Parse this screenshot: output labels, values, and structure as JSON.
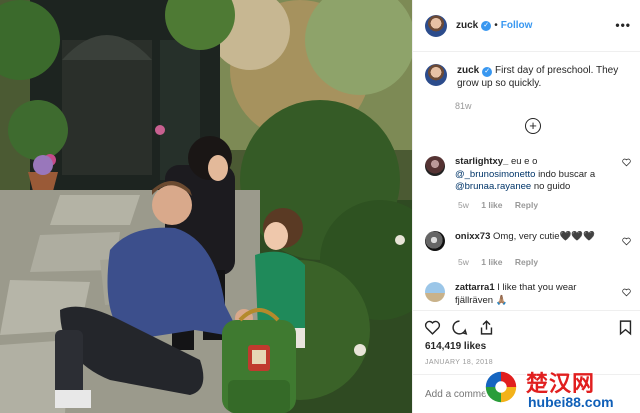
{
  "photo": {
    "alt": ""
  },
  "header": {
    "username": "zuck",
    "separator": "•",
    "follow_label": "Follow",
    "more_label": "•••"
  },
  "caption": {
    "username": "zuck",
    "text": "First day of preschool. They grow up so quickly.",
    "time_ago": "81w"
  },
  "load_more_label": "+",
  "comments": [
    {
      "username": "starlightxy_",
      "text_before": "eu e o",
      "mention1": "@_brunosimonetto",
      "text_middle": "indo buscar a",
      "mention2": "@brunaa.rayanee",
      "text_after": "no guido",
      "time": "5w",
      "likes": "1 like",
      "reply": "Reply"
    },
    {
      "username": "onixx73",
      "text": "Omg, very cutie🖤🖤🖤",
      "time": "5w",
      "likes": "1 like",
      "reply": "Reply"
    },
    {
      "username": "zattarra1",
      "text": "I like that you wear fjällräven 🙏🏽"
    }
  ],
  "stats": {
    "likes": "614,419 likes",
    "date": "JANUARY 18, 2018"
  },
  "add_comment": {
    "placeholder": "Add a comment..."
  },
  "watermark": {
    "cn": "楚汉网",
    "url": "hubei88.com"
  },
  "colors": {
    "accent": "#3897f0",
    "mention": "#003569",
    "muted": "#999999"
  },
  "icons": [
    "verified-badge-icon",
    "more-options-icon",
    "plus-circle-icon",
    "heart-icon",
    "comment-icon",
    "share-icon",
    "bookmark-icon"
  ]
}
